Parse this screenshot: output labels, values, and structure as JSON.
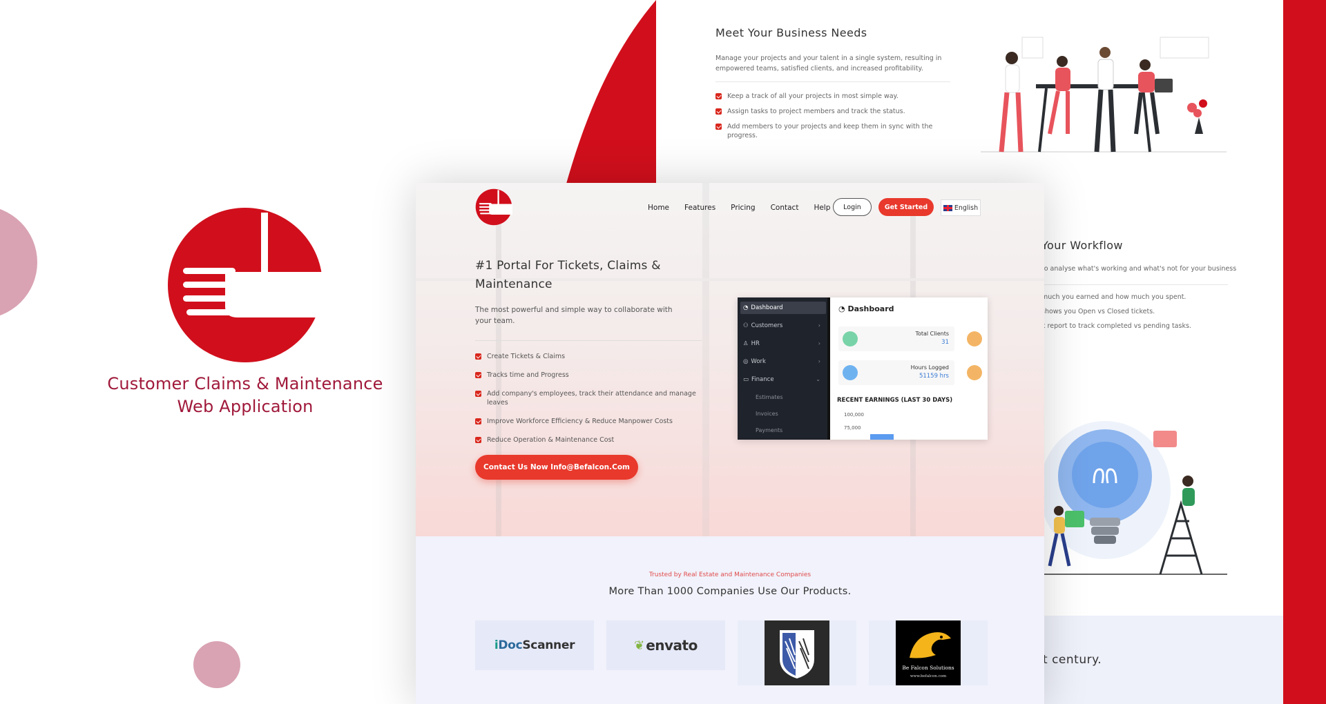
{
  "brand": {
    "title_line1": "Customer Claims & Maintenance",
    "title_line2": "Web Application",
    "color": "#a0193a"
  },
  "colors": {
    "accent_red": "#d10f1c",
    "button_red": "#e8392c",
    "blob_pink": "#d9a3b3",
    "sidebar_dark": "#1f232b"
  },
  "top_panel": {
    "title": "Meet Your Business Needs",
    "description": "Manage your projects and your talent in a single system, resulting in empowered teams, satisfied clients, and increased profitability.",
    "items": [
      "Keep a track of all your projects in most simple way.",
      "Assign tasks to project members and track the status.",
      "Add members to your projects and keep them in sync with the progress."
    ]
  },
  "right_panel": {
    "title": "Your Workflow",
    "description": "to analyse what's working and what's not for your business",
    "items": [
      "much you earned and how much you spent.",
      "shows you Open vs Closed tickets.",
      "k report to track completed vs pending tasks."
    ],
    "century_text": "t century."
  },
  "mockup": {
    "nav": [
      "Home",
      "Features",
      "Pricing",
      "Contact",
      "Help"
    ],
    "login_label": "Login",
    "get_started_label": "Get Started",
    "language": "English",
    "hero_title": "#1 Portal For Tickets, Claims & Maintenance",
    "hero_subtitle": "The most powerful and simple way to collaborate with your team.",
    "features": [
      "Create Tickets & Claims",
      "Tracks time and Progress",
      "Add company's employees, track their attendance and manage leaves",
      "Improve Workforce Efficiency & Reduce Manpower Costs",
      "Reduce Operation & Maintenance Cost"
    ],
    "cta_label": "Contact Us Now Info@Befalcon.Com",
    "dashboard": {
      "sidebar": [
        "Dashboard",
        "Customers",
        "HR",
        "Work",
        "Finance"
      ],
      "finance_sub": [
        "Estimates",
        "Invoices",
        "Payments"
      ],
      "title": "Dashboard",
      "cards": [
        {
          "label": "Total Clients",
          "value": "31"
        },
        {
          "label": "Hours Logged",
          "value": "51159 hrs"
        }
      ],
      "earnings_title": "RECENT EARNINGS (LAST 30 DAYS)",
      "ticks": [
        "100,000",
        "75,000"
      ]
    },
    "trusted_label": "Trusted by Real Estate and Maintenance Companies",
    "trusted_title": "More Than 1000 Companies Use Our Products.",
    "logos": {
      "idoc_i": "i",
      "idoc_doc": "Doc",
      "idoc_scanner": "Scanner",
      "envato": "envato",
      "befalcon_name": "Be Falcon Solutions",
      "befalcon_url": "www.befalcon.com"
    }
  }
}
